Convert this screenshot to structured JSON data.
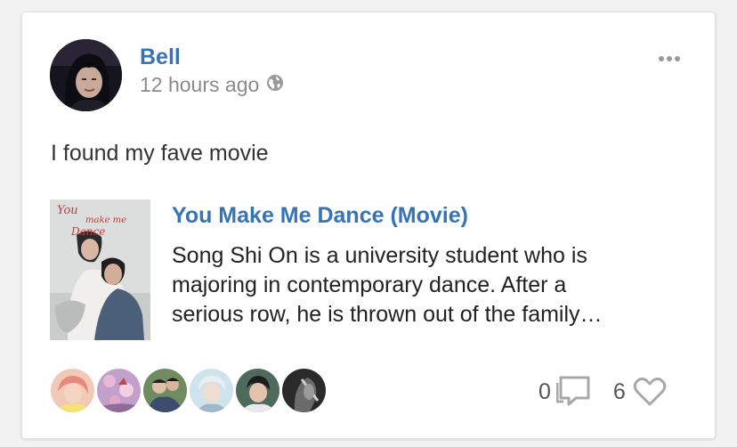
{
  "post": {
    "author": "Bell",
    "timestamp": "12 hours ago",
    "visibility_icon": "globe-icon",
    "text": "I found my fave movie",
    "menu_icon": "more-horizontal-icon"
  },
  "media": {
    "title": "You Make Me Dance (Movie)",
    "description_lines": [
      "Song Shi On is a university student who is",
      "majoring in contemporary dance. After a",
      "serious row, he is thrown out of the family…"
    ],
    "poster_title": "You make me Dance"
  },
  "footer": {
    "liker_count_shown": 6,
    "comments_count": "0",
    "likes_count": "6",
    "comment_icon": "comment-icon",
    "like_icon": "heart-icon"
  },
  "colors": {
    "link": "#3474b7",
    "muted": "#8a8a8a",
    "text": "#333333"
  }
}
